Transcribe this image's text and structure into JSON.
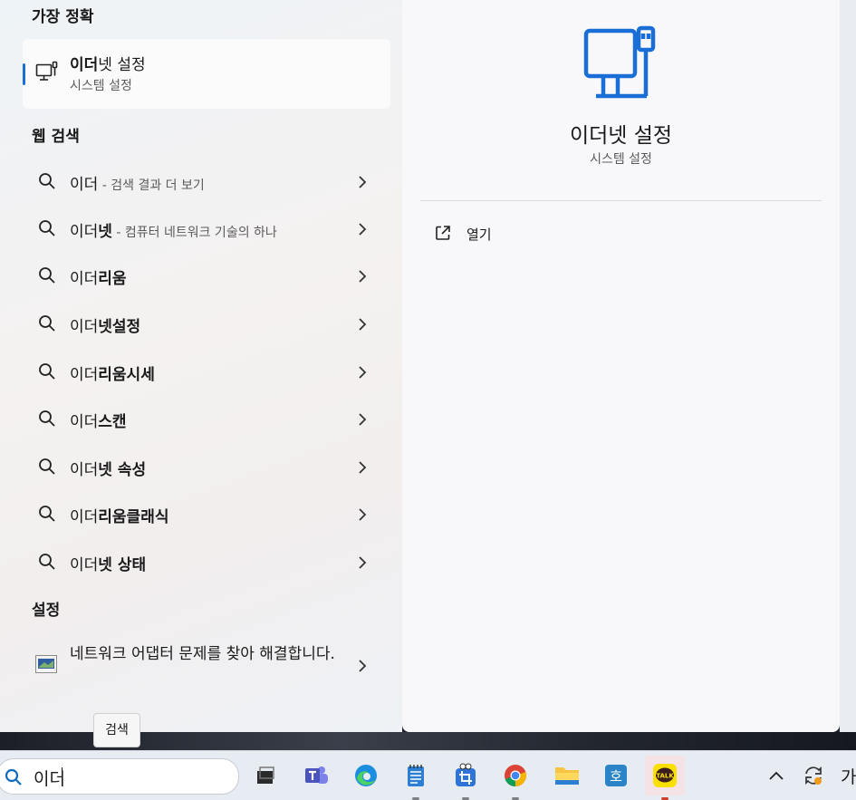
{
  "best_match": {
    "section_title": "가장 정확",
    "title_bold": "이더",
    "title_rest": "넷 설정",
    "subtitle": "시스템 설정",
    "icon": "ethernet-monitor-icon"
  },
  "web_search": {
    "section_title": "웹 검색",
    "items": [
      {
        "prefix": "이더",
        "bold": "",
        "hint": " - 검색 결과 더 보기"
      },
      {
        "prefix": "이더",
        "bold": "넷",
        "hint": " - 컴퓨터 네트워크 기술의 하나"
      },
      {
        "prefix": "이더",
        "bold": "리움",
        "hint": ""
      },
      {
        "prefix": "이더",
        "bold": "넷설정",
        "hint": ""
      },
      {
        "prefix": "이더",
        "bold": "리움시세",
        "hint": ""
      },
      {
        "prefix": "이더",
        "bold": "스캔",
        "hint": ""
      },
      {
        "prefix": "이더",
        "bold": "넷 속성",
        "hint": ""
      },
      {
        "prefix": "이더",
        "bold": "리움클래식",
        "hint": ""
      },
      {
        "prefix": "이더",
        "bold": "넷 상태",
        "hint": ""
      }
    ]
  },
  "settings": {
    "section_title": "설정",
    "item_label": "네트워크 어댑터 문제를 찾아 해결합니다."
  },
  "detail": {
    "title": "이더넷 설정",
    "subtitle": "시스템 설정",
    "open_label": "열기"
  },
  "tooltip": "검색",
  "taskbar": {
    "search_value": "이더",
    "apps": [
      "task-view-icon",
      "teams-icon",
      "edge-icon",
      "notepad-icon",
      "snipping-tool-icon",
      "chrome-icon",
      "file-explorer-icon",
      "hancom-icon",
      "kakaotalk-icon"
    ],
    "hancom_glyph": "호",
    "kakao_glyph": "TALK",
    "ime_label": "가"
  },
  "colors": {
    "accent": "#1a6fd6",
    "kakao": "#f9e000"
  }
}
